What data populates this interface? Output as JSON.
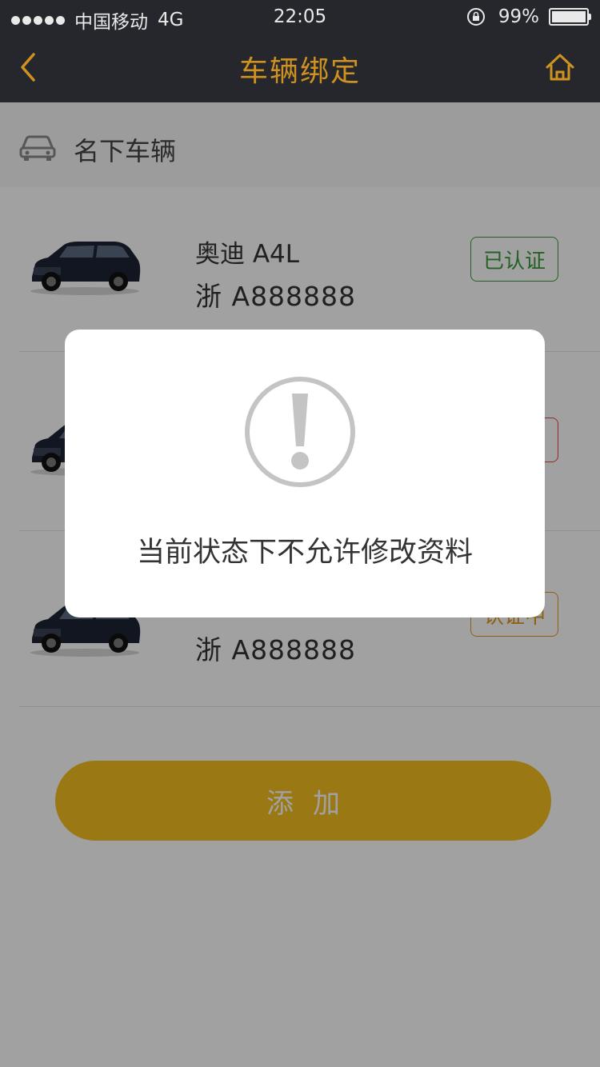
{
  "status_bar": {
    "carrier": "中国移动",
    "network": "4G",
    "time": "22:05",
    "battery": "99%",
    "battery_level": 0.99
  },
  "nav": {
    "title": "车辆绑定",
    "back_icon": "chevron-left-icon",
    "home_icon": "home-icon"
  },
  "section": {
    "icon": "car-icon",
    "title": "名下车辆"
  },
  "vehicles": [
    {
      "model": "奥迪 A4L",
      "plate": "浙 A888888",
      "status": "已认证",
      "status_color": "#3a9a3a"
    },
    {
      "model": "",
      "plate": "",
      "status": "",
      "status_color": "#e0473a"
    },
    {
      "model": "",
      "plate": "浙 A888888",
      "status": "认证中",
      "status_color": "#e09a20"
    }
  ],
  "add_button": {
    "label": "添加"
  },
  "dialog": {
    "icon": "alert-exclamation-icon",
    "message": "当前状态下不允许修改资料"
  },
  "colors": {
    "accent": "#cf9220",
    "button": "#f4be1f",
    "bar": "#25272c"
  }
}
